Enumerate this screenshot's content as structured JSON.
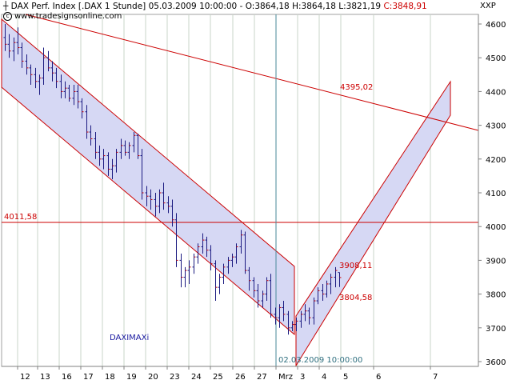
{
  "header": {
    "instrument": "DAX Perf. Index [.DAX  1 Stunde]",
    "datetime": "05.03.2009 10:00:00",
    "open": "O:3864,18",
    "high": "H:3864,18",
    "low": "L:3821,19",
    "close": "C:3848,91",
    "website": "www.tradesignsonline.com",
    "corner": "XXP"
  },
  "annotations": {
    "level_4011": "4011,58",
    "level_4395": "4395,02",
    "level_3908": "3908,11",
    "level_3804": "3804,58",
    "daximaxi": "DAXIMAXi",
    "cursor_date": "02.03.2009 10:00:00"
  },
  "colors": {
    "candle": "#1a1a80",
    "trendline": "#cc0000",
    "channel_fill": "#d6d8f4",
    "grid": "#c8d6c8",
    "cursor": "#4a8a9a"
  },
  "chart_data": {
    "type": "ohlc",
    "title": "DAX Perf. Index [.DAX  1 Stunde]",
    "xlabel": "",
    "ylabel": "",
    "ylim": [
      3580,
      4650
    ],
    "y_ticks": [
      3600,
      3700,
      3800,
      3900,
      4000,
      4100,
      4200,
      4300,
      4400,
      4500,
      4600
    ],
    "y_tick_labels": [
      "3600",
      "3700",
      "3800",
      "3900",
      "4000",
      "4100",
      "4200",
      "4300",
      "4400",
      "4500",
      "4600"
    ],
    "x_tick_labels": [
      "12",
      "13",
      "16",
      "17",
      "18",
      "19",
      "20",
      "23",
      "24",
      "25",
      "26",
      "27",
      "Mrz",
      "3",
      "4",
      "5",
      "6",
      "7"
    ],
    "horizontal_line": 4011.58,
    "series": [
      {
        "values": [
          [
            4560,
            4600,
            4520,
            4540
          ],
          [
            4540,
            4570,
            4500,
            4520
          ],
          [
            4520,
            4560,
            4490,
            4545
          ],
          [
            4545,
            4590,
            4510,
            4530
          ],
          [
            4530,
            4545,
            4470,
            4490
          ],
          [
            4490,
            4510,
            4450,
            4470
          ],
          [
            4470,
            4480,
            4420,
            4450
          ],
          [
            4450,
            4470,
            4410,
            4430
          ],
          [
            4430,
            4450,
            4390,
            4440
          ],
          [
            4440,
            4530,
            4420,
            4500
          ],
          [
            4500,
            4520,
            4460,
            4470
          ],
          [
            4470,
            4490,
            4430,
            4455
          ],
          [
            4455,
            4470,
            4410,
            4430
          ],
          [
            4430,
            4450,
            4380,
            4400
          ],
          [
            4400,
            4430,
            4380,
            4410
          ],
          [
            4410,
            4420,
            4370,
            4380
          ],
          [
            4380,
            4420,
            4360,
            4400
          ],
          [
            4400,
            4420,
            4350,
            4370
          ],
          [
            4370,
            4380,
            4320,
            4340
          ],
          [
            4340,
            4360,
            4260,
            4280
          ],
          [
            4280,
            4300,
            4240,
            4260
          ],
          [
            4260,
            4280,
            4200,
            4220
          ],
          [
            4220,
            4240,
            4180,
            4200
          ],
          [
            4200,
            4230,
            4170,
            4210
          ],
          [
            4210,
            4220,
            4150,
            4170
          ],
          [
            4170,
            4200,
            4140,
            4180
          ],
          [
            4180,
            4230,
            4160,
            4220
          ],
          [
            4220,
            4260,
            4200,
            4240
          ],
          [
            4240,
            4255,
            4210,
            4220
          ],
          [
            4220,
            4250,
            4200,
            4240
          ],
          [
            4240,
            4280,
            4220,
            4270
          ],
          [
            4270,
            4275,
            4200,
            4210
          ],
          [
            4210,
            4230,
            4080,
            4100
          ],
          [
            4100,
            4120,
            4060,
            4090
          ],
          [
            4090,
            4110,
            4050,
            4080
          ],
          [
            4080,
            4100,
            4030,
            4060
          ],
          [
            4060,
            4110,
            4040,
            4100
          ],
          [
            4100,
            4130,
            4050,
            4070
          ],
          [
            4070,
            4090,
            4040,
            4060
          ],
          [
            4060,
            4080,
            4000,
            4020
          ],
          [
            4020,
            4040,
            3880,
            3900
          ],
          [
            3900,
            3920,
            3820,
            3850
          ],
          [
            3850,
            3880,
            3820,
            3870
          ],
          [
            3870,
            3900,
            3830,
            3880
          ],
          [
            3880,
            3920,
            3860,
            3910
          ],
          [
            3910,
            3950,
            3890,
            3940
          ],
          [
            3940,
            3980,
            3920,
            3960
          ],
          [
            3960,
            3970,
            3910,
            3930
          ],
          [
            3930,
            3945,
            3870,
            3890
          ],
          [
            3890,
            3900,
            3780,
            3820
          ],
          [
            3820,
            3860,
            3800,
            3850
          ],
          [
            3850,
            3890,
            3830,
            3880
          ],
          [
            3880,
            3910,
            3860,
            3900
          ],
          [
            3900,
            3920,
            3880,
            3910
          ],
          [
            3910,
            3950,
            3890,
            3940
          ],
          [
            3940,
            3990,
            3920,
            3975
          ],
          [
            3975,
            3985,
            3860,
            3870
          ],
          [
            3870,
            3880,
            3810,
            3840
          ],
          [
            3840,
            3850,
            3790,
            3810
          ],
          [
            3810,
            3830,
            3760,
            3780
          ],
          [
            3780,
            3810,
            3760,
            3800
          ],
          [
            3800,
            3850,
            3780,
            3840
          ],
          [
            3840,
            3860,
            3730,
            3740
          ],
          [
            3740,
            3760,
            3710,
            3730
          ],
          [
            3730,
            3770,
            3700,
            3760
          ],
          [
            3760,
            3780,
            3720,
            3740
          ],
          [
            3740,
            3750,
            3680,
            3700
          ],
          [
            3700,
            3720,
            3690,
            3710
          ],
          [
            3710,
            3730,
            3690,
            3720
          ],
          [
            3720,
            3750,
            3700,
            3740
          ],
          [
            3740,
            3770,
            3720,
            3750
          ],
          [
            3750,
            3760,
            3710,
            3730
          ],
          [
            3730,
            3790,
            3710,
            3780
          ],
          [
            3780,
            3820,
            3770,
            3810
          ],
          [
            3810,
            3830,
            3780,
            3800
          ],
          [
            3800,
            3840,
            3790,
            3830
          ],
          [
            3830,
            3860,
            3800,
            3850
          ],
          [
            3850,
            3880,
            3820,
            3870
          ],
          [
            3864,
            3864,
            3821,
            3849
          ]
        ]
      }
    ]
  }
}
